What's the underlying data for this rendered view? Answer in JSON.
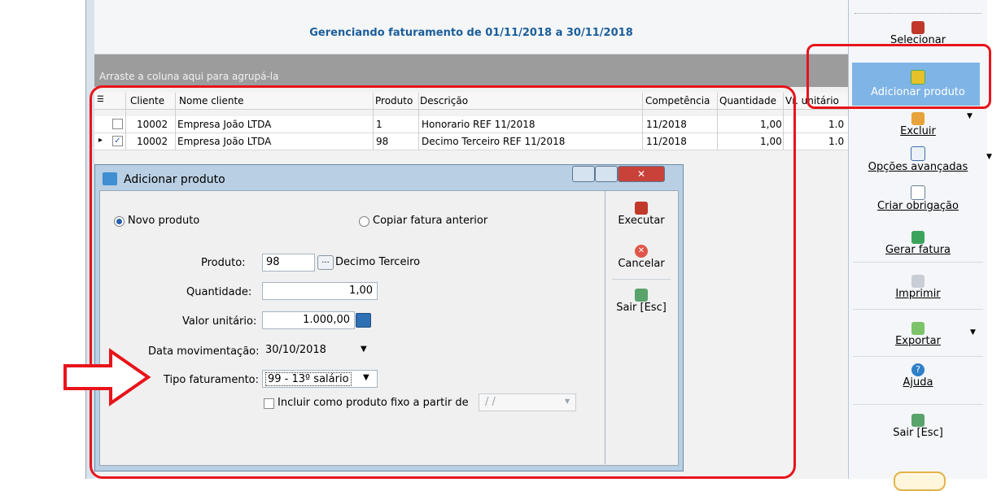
{
  "header": {
    "title": "Gerenciando faturamento de 01/11/2018 a 30/11/2018"
  },
  "grid": {
    "group_hint": "Arraste a coluna aqui para agrupá-la",
    "columns": [
      "Cliente",
      "Nome cliente",
      "Produto",
      "Descrição",
      "Competência",
      "Quantidade",
      "Vr. unitário"
    ],
    "rows": [
      {
        "cliente": "10002",
        "nome": "Empresa João LTDA",
        "produto": "1",
        "descricao": "Honorario REF 11/2018",
        "competencia": "11/2018",
        "quantidade": "1,00",
        "vr": "1.0",
        "checked": false
      },
      {
        "cliente": "10002",
        "nome": "Empresa João LTDA",
        "produto": "98",
        "descricao": "Decimo Terceiro REF 11/2018",
        "competencia": "11/2018",
        "quantidade": "1,00",
        "vr": "1.0",
        "checked": true
      }
    ]
  },
  "toolbar": {
    "selecionar": "Selecionar",
    "adicionar": "Adicionar produto",
    "excluir": "Excluir",
    "opcoes": "Opções avançadas",
    "criar": "Criar obrigação",
    "gerar": "Gerar fatura",
    "imprimir": "Imprimir",
    "exportar": "Exportar",
    "ajuda": "Ajuda",
    "sair": "Sair [Esc]"
  },
  "dialog": {
    "title": "Adicionar produto",
    "radio_novo": "Novo produto",
    "radio_copiar": "Copiar fatura anterior",
    "produto_label": "Produto:",
    "produto_value": "98",
    "produto_desc": "Decimo Terceiro",
    "browse_label": "...",
    "quantidade_label": "Quantidade:",
    "quantidade_value": "1,00",
    "valor_label": "Valor unitário:",
    "valor_value": "1.000,00",
    "data_label": "Data movimentação:",
    "data_value": "30/10/2018",
    "tipo_label": "Tipo faturamento:",
    "tipo_value": "99 - 13º salário",
    "incluir_label": "Incluir como produto fixo a partir de",
    "incluir_date": "/ /",
    "executar": "Executar",
    "cancelar": "Cancelar",
    "sair": "Sair [Esc]"
  },
  "colors": {
    "highlight": "#e8141a",
    "title_blue": "#1b5e9a",
    "selected_button": "#7fb4e6"
  }
}
